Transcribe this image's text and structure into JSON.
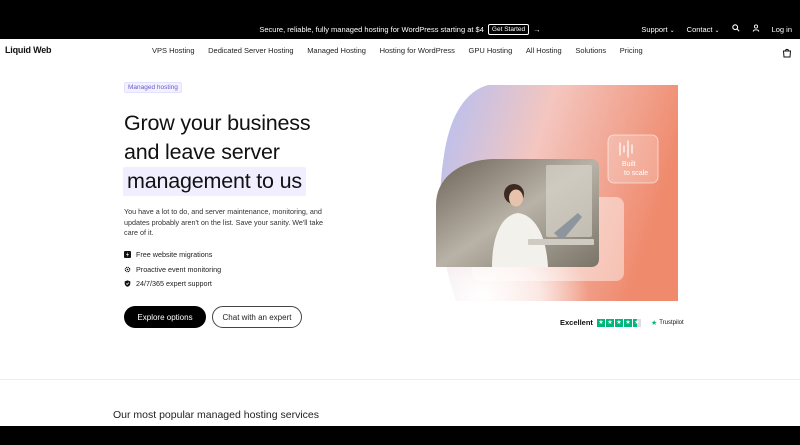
{
  "promo": {
    "text": "Secure, reliable, fully managed hosting for WordPress starting at $4",
    "cta": "Get Started",
    "cta_arrow": "→",
    "support": "Support",
    "contact": "Contact",
    "login": "Log in"
  },
  "nav": {
    "logo": "Liquid Web",
    "items": [
      "VPS Hosting",
      "Dedicated Server Hosting",
      "Managed Hosting",
      "Hosting for WordPress",
      "GPU Hosting",
      "All Hosting",
      "Solutions",
      "Pricing"
    ]
  },
  "hero": {
    "badge": "Managed hosting",
    "title_line1": "Grow your business",
    "title_line2": "and leave server",
    "title_line3": "management to us",
    "description": "You have a lot to do, and server maintenance, monitoring, and updates probably aren't on the list. Save your sanity. We'll take care of it.",
    "features": [
      "Free website migrations",
      "Proactive event monitoring",
      "24/7/365 expert support"
    ],
    "primary_button": "Explore options",
    "secondary_button": "Chat with an expert",
    "visual_card_label_1": "Built",
    "visual_card_label_2": "to scale"
  },
  "trustpilot": {
    "rating_text": "Excellent",
    "stars": 4.5,
    "brand": "Trustpilot"
  },
  "section": {
    "title": "Our most popular managed hosting services"
  },
  "colors": {
    "accent": "#6a5acd",
    "trustpilot": "#00b67a",
    "gradient_orange": "#f08a6a",
    "gradient_blue": "#a9b6f3"
  },
  "icons": {
    "feature_icons": [
      "bolt-icon",
      "gear-icon",
      "shield-check-icon"
    ],
    "search": "search-icon",
    "user": "user-icon",
    "cart": "cart-icon"
  }
}
